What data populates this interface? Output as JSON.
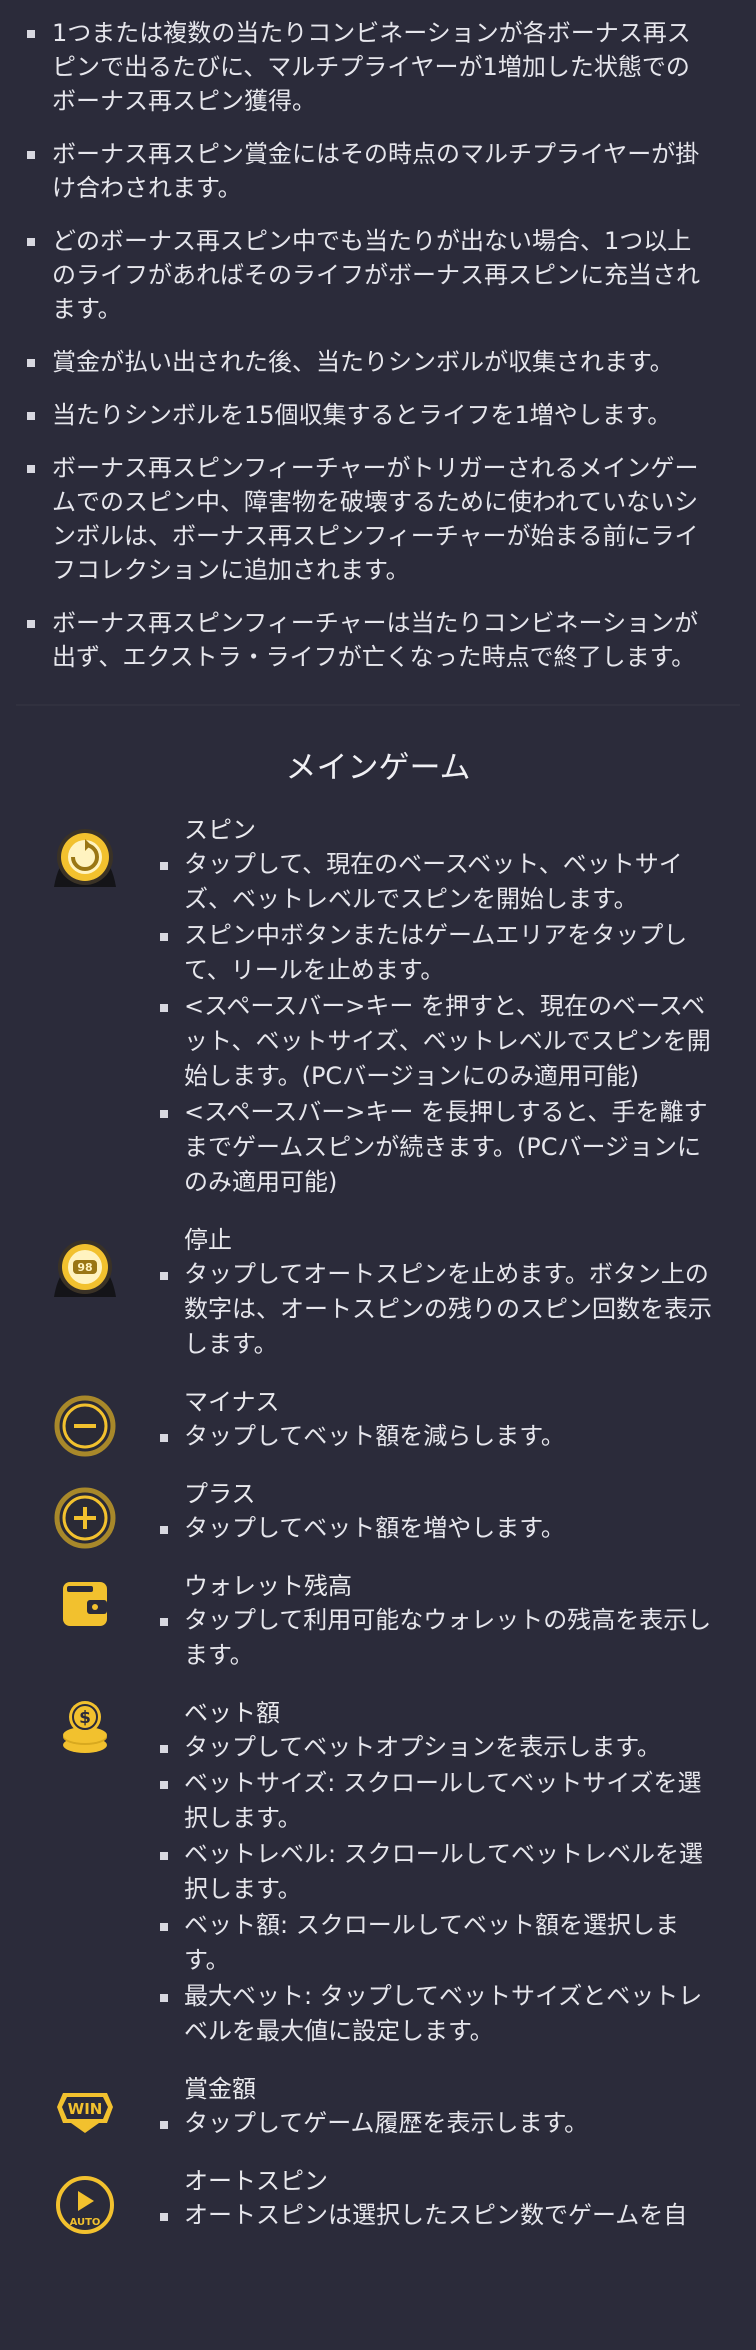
{
  "rules": [
    "1つまたは複数の当たりコンビネーションが各ボーナス再スピンで出るたびに、マルチプライヤーが1増加した状態でのボーナス再スピン獲得。",
    "ボーナス再スピン賞金にはその時点のマルチプライヤーが掛け合わされます。",
    "どのボーナス再スピン中でも当たりが出ない場合、1つ以上のライフがあればそのライフがボーナス再スピンに充当されます。",
    "賞金が払い出された後、当たりシンボルが収集されます。",
    "当たりシンボルを15個収集するとライフを1増やします。",
    "ボーナス再スピンフィーチャーがトリガーされるメインゲームでのスピン中、障害物を破壊するために使われていないシンボルは、ボーナス再スピンフィーチャーが始まる前にライフコレクションに追加されます。",
    "ボーナス再スピンフィーチャーは当たりコンビネーションが出ず、エクストラ・ライフが亡くなった時点で終了します。"
  ],
  "main_game": {
    "title": "メインゲーム",
    "controls": [
      {
        "icon": "spin-button-icon",
        "name": "スピン",
        "items": [
          "タップして、現在のベースベット、ベットサイズ、ベットレベルでスピンを開始します。",
          "スピン中ボタンまたはゲームエリアをタップして、リールを止めます。",
          "<スペースバー>キー を押すと、現在のベースベット、ベットサイズ、ベットレベルでスピンを開始します。(PCバージョンにのみ適用可能)",
          "<スペースバー>キー を長押しすると、手を離すまでゲームスピンが続きます。(PCバージョンにのみ適用可能)"
        ]
      },
      {
        "icon": "stop-button-icon",
        "icon_label": "98",
        "name": "停止",
        "items": [
          "タップしてオートスピンを止めます。ボタン上の数字は、オートスピンの残りのスピン回数を表示します。"
        ]
      },
      {
        "icon": "minus-icon",
        "name": "マイナス",
        "items": [
          "タップしてベット額を減らします。"
        ]
      },
      {
        "icon": "plus-icon",
        "name": "プラス",
        "items": [
          "タップしてベット額を増やします。"
        ]
      },
      {
        "icon": "wallet-icon",
        "name": "ウォレット残高",
        "items": [
          "タップして利用可能なウォレットの残高を表示します。"
        ]
      },
      {
        "icon": "coins-icon",
        "name": "ベット額",
        "items": [
          "タップしてベットオプションを表示します。",
          "ベットサイズ: スクロールしてベットサイズを選択します。",
          "ベットレベル: スクロールしてベットレベルを選択します。",
          "ベット額: スクロールしてベット額を選択します。",
          "最大ベット: タップしてベットサイズとベットレベルを最大値に設定します。"
        ]
      },
      {
        "icon": "win-icon",
        "icon_label": "WIN",
        "name": "賞金額",
        "items": [
          "タップしてゲーム履歴を表示します。"
        ]
      },
      {
        "icon": "autospin-icon",
        "icon_label": "AUTO",
        "name": "オートスピン",
        "items": [
          "オートスピンは選択したスピン数でゲームを自"
        ]
      }
    ]
  },
  "colors": {
    "background": "#2b2b3a",
    "accent_gold": "#f2c12e",
    "text": "#e6e6ec"
  }
}
